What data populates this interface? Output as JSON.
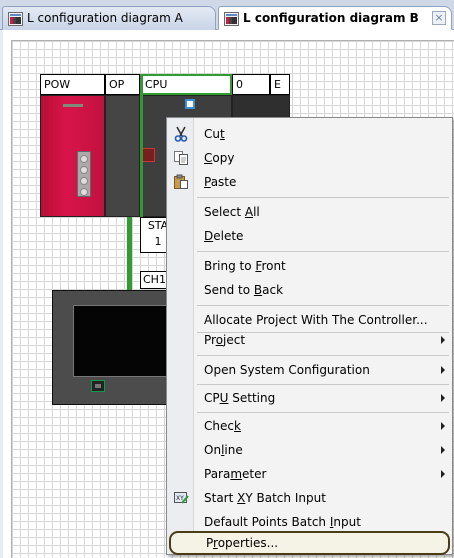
{
  "tabs": [
    {
      "label": "L configuration diagram A",
      "active": false,
      "icon": "diagram-icon"
    },
    {
      "label": "L configuration diagram B",
      "active": true,
      "icon": "diagram-icon"
    }
  ],
  "tab_close_glyph": "×",
  "diagram": {
    "module_labels": {
      "pow": "POW",
      "op": "OP",
      "cpu": "CPU",
      "slot0": "0",
      "e": "E"
    },
    "station_label_line1": "STA",
    "station_label_line2": "1",
    "channel_label": "CH1"
  },
  "context_menu": {
    "items": [
      {
        "pre": "Cu",
        "acc": "t",
        "post": "",
        "icon": "scissors-icon"
      },
      {
        "pre": "",
        "acc": "C",
        "post": "opy",
        "icon": "copy-icon"
      },
      {
        "pre": "",
        "acc": "P",
        "post": "aste",
        "icon": "paste-icon"
      },
      {
        "pre": "Select ",
        "acc": "A",
        "post": "ll"
      },
      {
        "pre": "",
        "acc": "D",
        "post": "elete"
      },
      {
        "pre": "Bring to ",
        "acc": "F",
        "post": "ront"
      },
      {
        "pre": "Send to ",
        "acc": "B",
        "post": "ack"
      },
      {
        "pre": "Allocate Project With The Controller...",
        "acc": "",
        "post": ""
      },
      {
        "pre": "Pr",
        "acc": "o",
        "post": "ject",
        "submenu": true
      },
      {
        "pre": "Open System Configuration",
        "acc": "",
        "post": "",
        "submenu": true
      },
      {
        "pre": "CP",
        "acc": "U",
        "post": " Setting",
        "submenu": true
      },
      {
        "pre": "Chec",
        "acc": "k",
        "post": "",
        "submenu": true
      },
      {
        "pre": "On",
        "acc": "l",
        "post": "ine",
        "submenu": true
      },
      {
        "pre": "Para",
        "acc": "m",
        "post": "eter",
        "submenu": true
      },
      {
        "pre": "Start ",
        "acc": "X",
        "post": "Y Batch Input",
        "icon": "xy-batch-icon"
      },
      {
        "pre": "Default Points Batch ",
        "acc": "I",
        "post": "nput"
      },
      {
        "pre": "P",
        "acc": "r",
        "post": "operties...",
        "highlighted": true
      }
    ]
  },
  "colors": {
    "power_module": "#c8123f",
    "link_line": "#2e9c2e",
    "selection_marker": "#3a8fd6"
  }
}
